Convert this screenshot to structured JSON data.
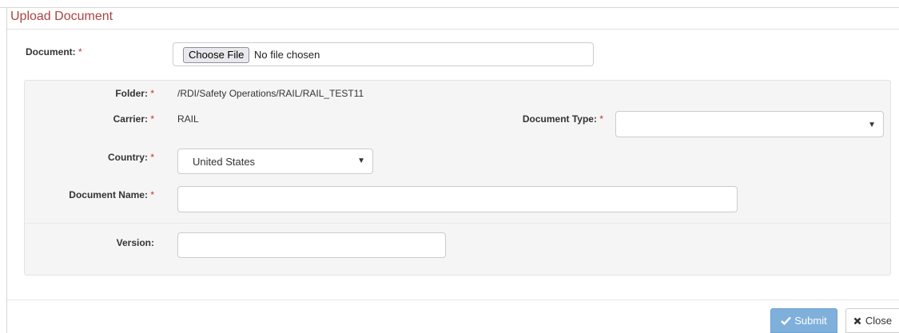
{
  "dialog": {
    "title": "Upload Document"
  },
  "form": {
    "required_marker": "*",
    "document": {
      "label": "Document:",
      "button_label": "Choose File",
      "status": "No file chosen"
    },
    "folder": {
      "label": "Folder:",
      "value": "/RDI/Safety Operations/RAIL/RAIL_TEST11"
    },
    "carrier": {
      "label": "Carrier:",
      "value": "RAIL"
    },
    "document_type": {
      "label": "Document Type:",
      "value": ""
    },
    "country": {
      "label": "Country:",
      "value": "United States"
    },
    "document_name": {
      "label": "Document Name:",
      "value": ""
    },
    "version": {
      "label": "Version:",
      "value": ""
    }
  },
  "footer": {
    "submit_label": "Submit",
    "close_label": "Close"
  },
  "icons": {
    "submit": "check-icon",
    "close": "x-icon",
    "dropdown": "caret-down-icon"
  },
  "colors": {
    "title": "#a94442",
    "required": "#c9302c",
    "submit_bg": "#7fb0dc",
    "panel_bg": "#f5f5f5"
  }
}
